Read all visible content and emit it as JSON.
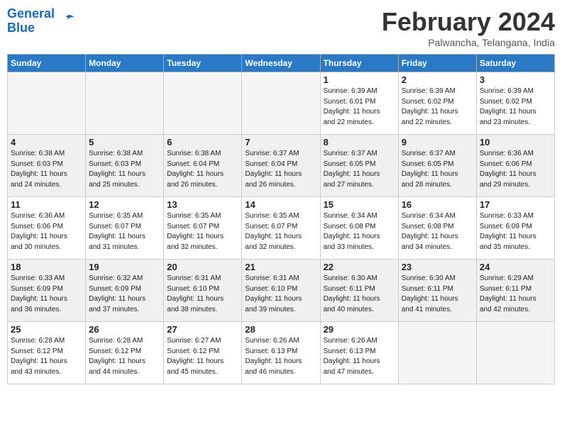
{
  "header": {
    "logo_line1": "General",
    "logo_line2": "Blue",
    "month": "February 2024",
    "location": "Palwancha, Telangana, India"
  },
  "days_of_week": [
    "Sunday",
    "Monday",
    "Tuesday",
    "Wednesday",
    "Thursday",
    "Friday",
    "Saturday"
  ],
  "weeks": [
    [
      {
        "day": "",
        "info": "",
        "empty": true
      },
      {
        "day": "",
        "info": "",
        "empty": true
      },
      {
        "day": "",
        "info": "",
        "empty": true
      },
      {
        "day": "",
        "info": "",
        "empty": true
      },
      {
        "day": "1",
        "info": "Sunrise: 6:39 AM\nSunset: 6:01 PM\nDaylight: 11 hours\nand 22 minutes."
      },
      {
        "day": "2",
        "info": "Sunrise: 6:39 AM\nSunset: 6:02 PM\nDaylight: 11 hours\nand 22 minutes."
      },
      {
        "day": "3",
        "info": "Sunrise: 6:39 AM\nSunset: 6:02 PM\nDaylight: 11 hours\nand 23 minutes."
      }
    ],
    [
      {
        "day": "4",
        "info": "Sunrise: 6:38 AM\nSunset: 6:03 PM\nDaylight: 11 hours\nand 24 minutes.",
        "shaded": true
      },
      {
        "day": "5",
        "info": "Sunrise: 6:38 AM\nSunset: 6:03 PM\nDaylight: 11 hours\nand 25 minutes.",
        "shaded": true
      },
      {
        "day": "6",
        "info": "Sunrise: 6:38 AM\nSunset: 6:04 PM\nDaylight: 11 hours\nand 26 minutes.",
        "shaded": true
      },
      {
        "day": "7",
        "info": "Sunrise: 6:37 AM\nSunset: 6:04 PM\nDaylight: 11 hours\nand 26 minutes.",
        "shaded": true
      },
      {
        "day": "8",
        "info": "Sunrise: 6:37 AM\nSunset: 6:05 PM\nDaylight: 11 hours\nand 27 minutes.",
        "shaded": true
      },
      {
        "day": "9",
        "info": "Sunrise: 6:37 AM\nSunset: 6:05 PM\nDaylight: 11 hours\nand 28 minutes.",
        "shaded": true
      },
      {
        "day": "10",
        "info": "Sunrise: 6:36 AM\nSunset: 6:06 PM\nDaylight: 11 hours\nand 29 minutes.",
        "shaded": true
      }
    ],
    [
      {
        "day": "11",
        "info": "Sunrise: 6:36 AM\nSunset: 6:06 PM\nDaylight: 11 hours\nand 30 minutes."
      },
      {
        "day": "12",
        "info": "Sunrise: 6:35 AM\nSunset: 6:07 PM\nDaylight: 11 hours\nand 31 minutes."
      },
      {
        "day": "13",
        "info": "Sunrise: 6:35 AM\nSunset: 6:07 PM\nDaylight: 11 hours\nand 32 minutes."
      },
      {
        "day": "14",
        "info": "Sunrise: 6:35 AM\nSunset: 6:07 PM\nDaylight: 11 hours\nand 32 minutes."
      },
      {
        "day": "15",
        "info": "Sunrise: 6:34 AM\nSunset: 6:08 PM\nDaylight: 11 hours\nand 33 minutes."
      },
      {
        "day": "16",
        "info": "Sunrise: 6:34 AM\nSunset: 6:08 PM\nDaylight: 11 hours\nand 34 minutes."
      },
      {
        "day": "17",
        "info": "Sunrise: 6:33 AM\nSunset: 6:09 PM\nDaylight: 11 hours\nand 35 minutes."
      }
    ],
    [
      {
        "day": "18",
        "info": "Sunrise: 6:33 AM\nSunset: 6:09 PM\nDaylight: 11 hours\nand 36 minutes.",
        "shaded": true
      },
      {
        "day": "19",
        "info": "Sunrise: 6:32 AM\nSunset: 6:09 PM\nDaylight: 11 hours\nand 37 minutes.",
        "shaded": true
      },
      {
        "day": "20",
        "info": "Sunrise: 6:31 AM\nSunset: 6:10 PM\nDaylight: 11 hours\nand 38 minutes.",
        "shaded": true
      },
      {
        "day": "21",
        "info": "Sunrise: 6:31 AM\nSunset: 6:10 PM\nDaylight: 11 hours\nand 39 minutes.",
        "shaded": true
      },
      {
        "day": "22",
        "info": "Sunrise: 6:30 AM\nSunset: 6:11 PM\nDaylight: 11 hours\nand 40 minutes.",
        "shaded": true
      },
      {
        "day": "23",
        "info": "Sunrise: 6:30 AM\nSunset: 6:11 PM\nDaylight: 11 hours\nand 41 minutes.",
        "shaded": true
      },
      {
        "day": "24",
        "info": "Sunrise: 6:29 AM\nSunset: 6:11 PM\nDaylight: 11 hours\nand 42 minutes.",
        "shaded": true
      }
    ],
    [
      {
        "day": "25",
        "info": "Sunrise: 6:28 AM\nSunset: 6:12 PM\nDaylight: 11 hours\nand 43 minutes."
      },
      {
        "day": "26",
        "info": "Sunrise: 6:28 AM\nSunset: 6:12 PM\nDaylight: 11 hours\nand 44 minutes."
      },
      {
        "day": "27",
        "info": "Sunrise: 6:27 AM\nSunset: 6:12 PM\nDaylight: 11 hours\nand 45 minutes."
      },
      {
        "day": "28",
        "info": "Sunrise: 6:26 AM\nSunset: 6:13 PM\nDaylight: 11 hours\nand 46 minutes."
      },
      {
        "day": "29",
        "info": "Sunrise: 6:26 AM\nSunset: 6:13 PM\nDaylight: 11 hours\nand 47 minutes."
      },
      {
        "day": "",
        "info": "",
        "empty": true
      },
      {
        "day": "",
        "info": "",
        "empty": true
      }
    ]
  ]
}
